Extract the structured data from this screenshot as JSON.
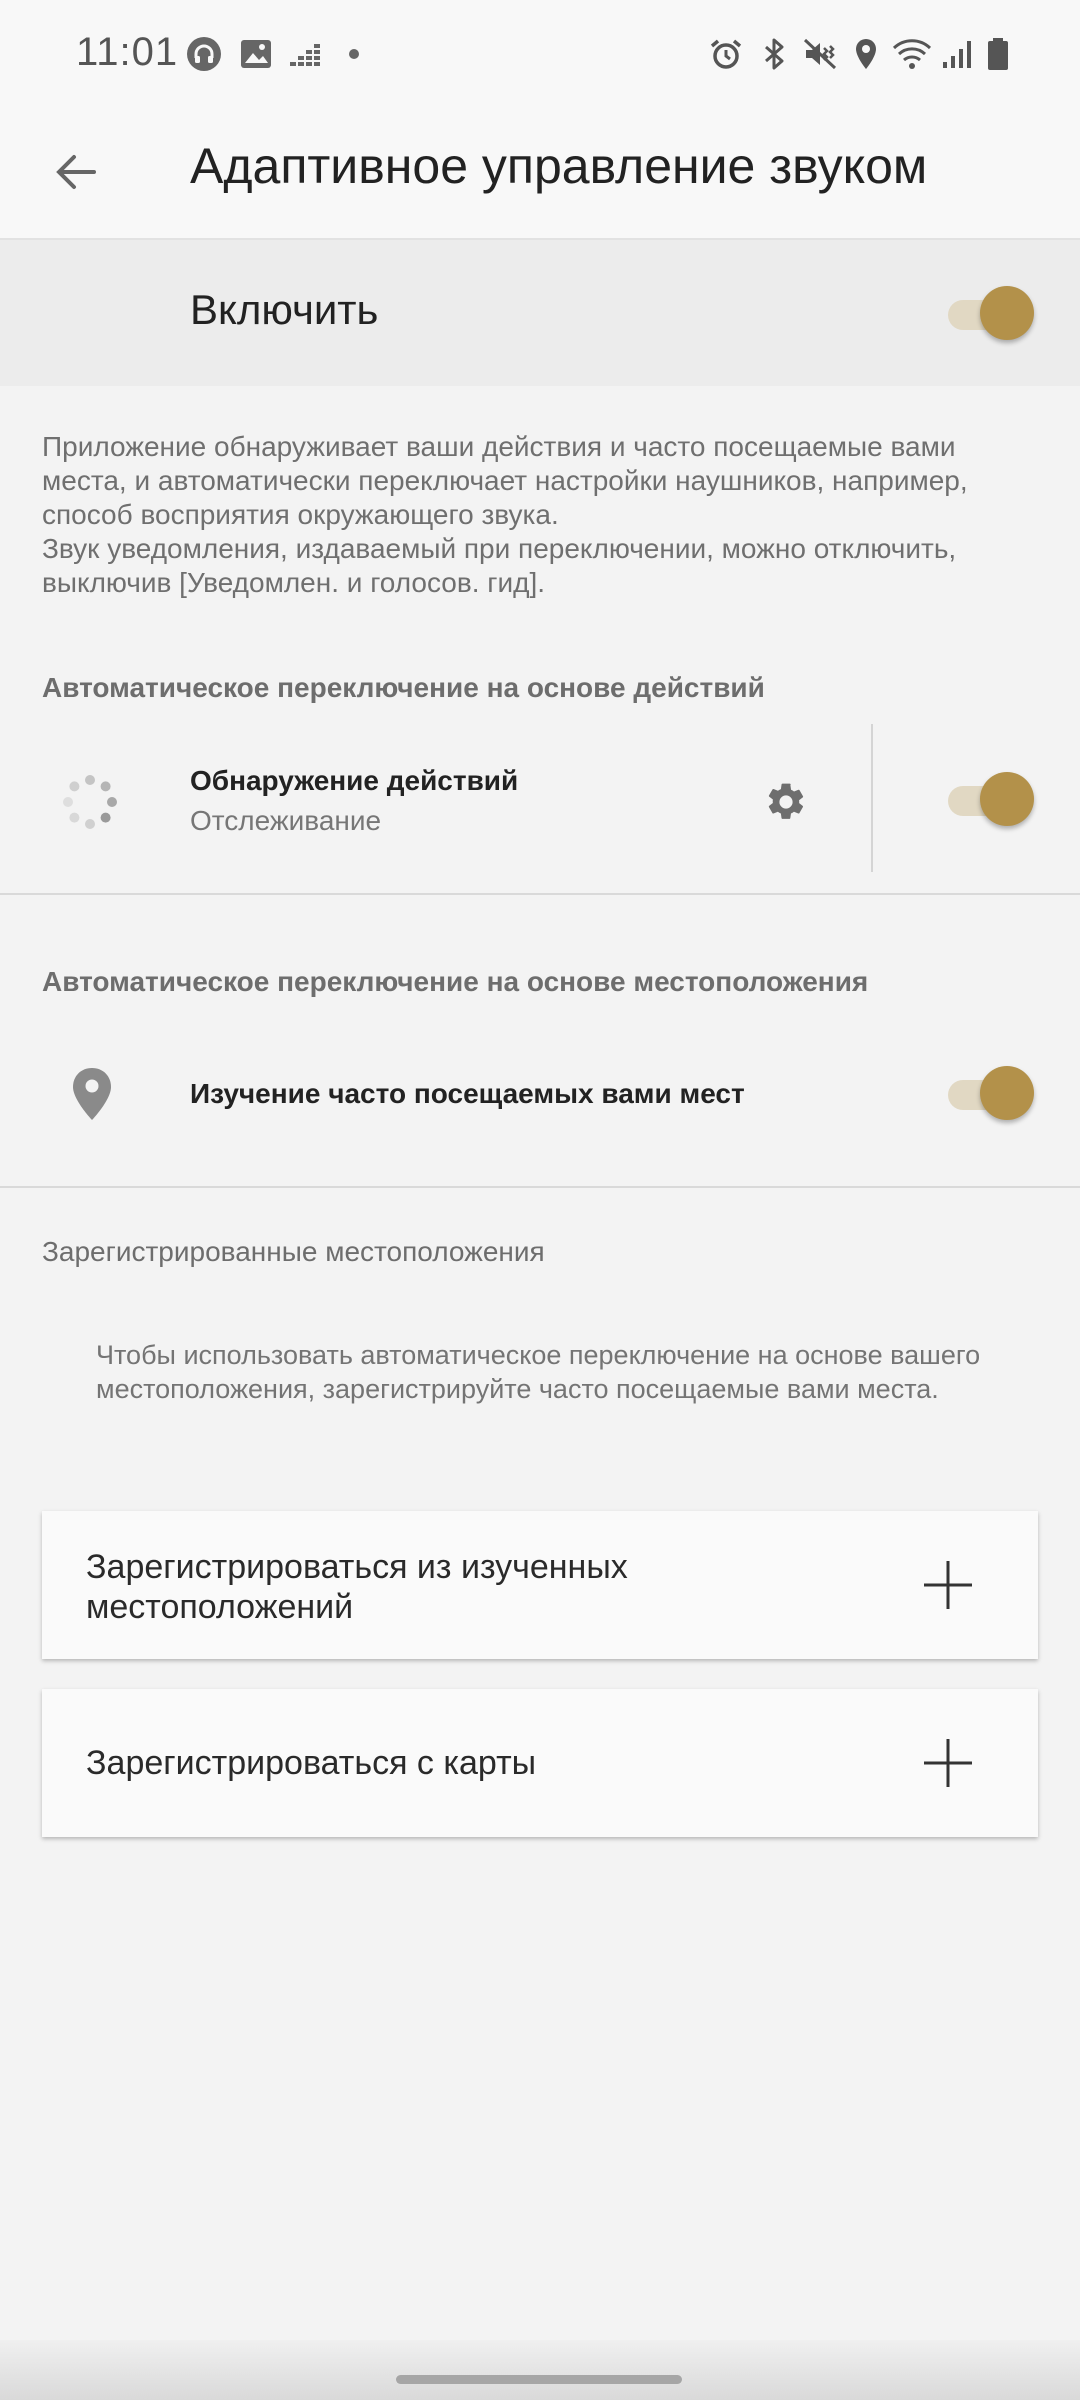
{
  "status_bar": {
    "time": "11:01"
  },
  "header": {
    "title": "Адаптивное управление звуком"
  },
  "master": {
    "label": "Включить",
    "enabled": true
  },
  "description": {
    "line1": "Приложение обнаруживает ваши действия и часто посещаемые вами места, и автоматически переключает настройки наушников, например, способ восприятия окружающего звука.",
    "line2": "Звук уведомления, издаваемый при переключении, можно отключить, выключив [Уведомлен. и голосов. гид]."
  },
  "actions_section": {
    "header": "Автоматическое переключение на основе действий",
    "item": {
      "title": "Обнаружение действий",
      "subtitle": "Отслеживание",
      "enabled": true
    }
  },
  "location_section": {
    "header": "Автоматическое переключение на основе местоположения",
    "item": {
      "title": "Изучение часто посещаемых вами мест",
      "enabled": true
    }
  },
  "registered": {
    "label": "Зарегистрированные местоположения",
    "hint": "Чтобы использовать автоматическое переключение на основе вашего местоположения, зарегистрируйте часто посещаемые вами места.",
    "options": [
      {
        "label": "Зарегистрироваться из изученных местоположений"
      },
      {
        "label": "Зарегистрироваться с карты"
      }
    ]
  },
  "colors": {
    "accent": "#b3914a",
    "track": "#e1d8c3",
    "background": "#f3f3f3"
  }
}
